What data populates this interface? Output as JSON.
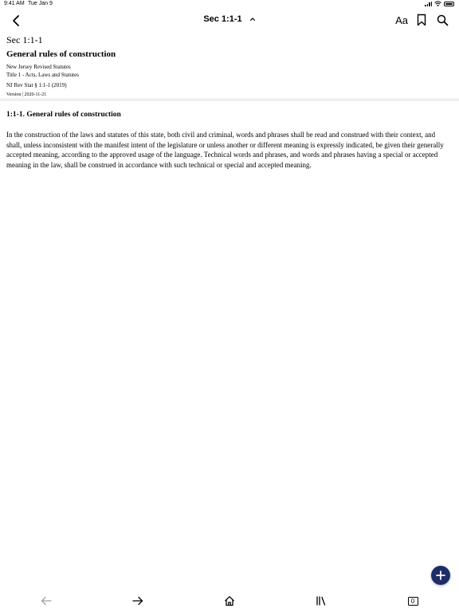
{
  "status_bar": {
    "time": "9:41 AM",
    "date": "Tue Jan 9",
    "icons": [
      "cellular-signal-icon",
      "wifi-icon",
      "battery-icon"
    ]
  },
  "nav": {
    "title": "Sec 1:1-1",
    "font_button_label": "Aa",
    "icons": [
      "back-chevron-icon",
      "chevron-up-icon",
      "bookmark-icon",
      "search-icon"
    ]
  },
  "document": {
    "section_label": "Sec 1:1-1",
    "title": "General rules of construction",
    "source": "New Jersey Revised Statutes",
    "title_path": "Title 1 - Acts, Laws and Statutes",
    "citation": "NJ Rev Stat § 1:1-1 (2019)",
    "version": "Version | 2020-11-21"
  },
  "content": {
    "heading": "1:1-1. General rules of construction",
    "body": "In the construction of the laws and statutes of this state, both civil and criminal, words and phrases shall be read and construed with their context, and shall, unless inconsistent with the manifest intent of the legislature or unless another or different meaning is expressly indicated, be given their generally accepted meaning, according to the approved usage of the language. Technical words and phrases, and words and phrases having a special or accepted meaning in the law, shall be construed in accordance with such technical or special and accepted meaning."
  },
  "fab": {
    "icon": "plus-icon",
    "color": "#1d2d6b"
  },
  "toolbar": {
    "items": [
      "arrow-left-icon",
      "arrow-right-icon",
      "home-icon",
      "library-icon",
      "tabs-icon"
    ],
    "tab_count": "0"
  },
  "colors": {
    "divider": "#f0f0f0",
    "accent": "#1d2d6b"
  }
}
